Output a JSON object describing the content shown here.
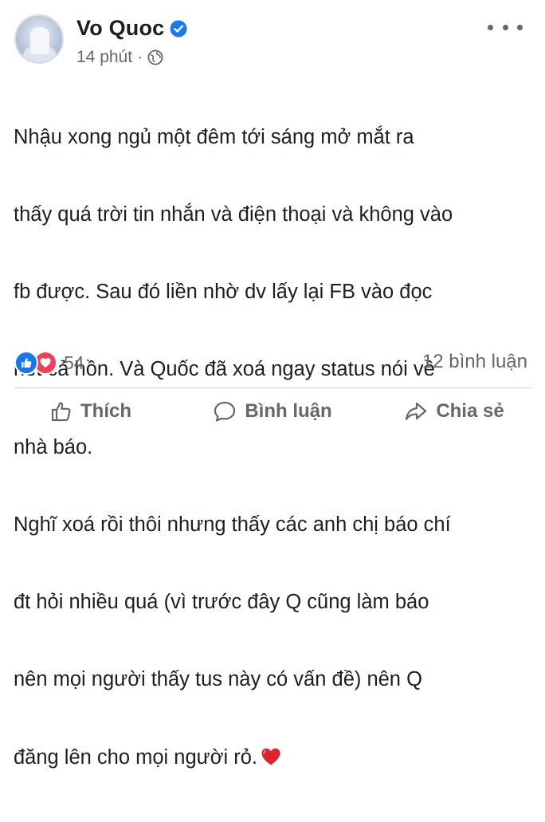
{
  "post": {
    "author": "Vo Quoc",
    "time": "14 phút",
    "separator": "·",
    "body_lines": [
      "Nhậu xong ngủ một đêm tới sáng mở mắt ra",
      "thấy quá trời tin nhắn và điện thoại và không vào",
      "fb được. Sau đó liền nhờ dv lấy lại FB vào đọc",
      "hết cả hồn. Và Quốc đã xoá ngay status nói về",
      "nhà báo.",
      "Nghĩ xoá rồi thôi nhưng thấy các anh chị báo chí",
      "đt hỏi nhiều quá (vì trước đây Q cũng làm báo",
      "nên mọi người thấy tus này có vấn đề) nên Q",
      "đăng lên cho mọi người rỏ."
    ],
    "emoji": "heart-emoji-icon",
    "reaction_icons": [
      "like-reaction-icon",
      "love-reaction-icon"
    ],
    "reaction_count": "54",
    "comment_count": "12 bình luận",
    "accent_color": "#1877f2",
    "love_color": "#f33e58"
  },
  "actions": {
    "like": "Thích",
    "comment": "Bình luận",
    "share": "Chia sẻ"
  }
}
